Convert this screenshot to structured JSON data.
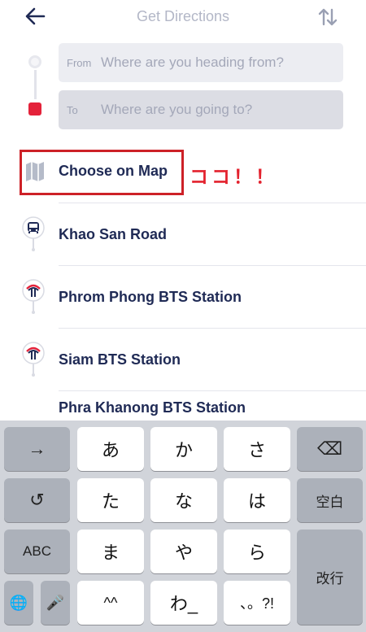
{
  "header": {
    "title": "Get Directions",
    "back_icon": "arrow-left-icon",
    "swap_icon": "swap-vertical-icon"
  },
  "route": {
    "from_label": "From",
    "from_placeholder": "Where are you heading from?",
    "to_label": "To",
    "to_placeholder": "Where are you going to?"
  },
  "annotation": "ココ！！",
  "places": [
    {
      "label": "Choose on Map",
      "icon": "map-icon"
    },
    {
      "label": "Khao San Road",
      "icon": "bus-stop-icon"
    },
    {
      "label": "Phrom Phong BTS Station",
      "icon": "bts-station-icon"
    },
    {
      "label": "Siam BTS Station",
      "icon": "bts-station-icon"
    },
    {
      "label": "Phra Khanong BTS Station",
      "icon": "bts-station-icon"
    }
  ],
  "keyboard": {
    "row1": [
      "→",
      "あ",
      "か",
      "さ",
      "⌫"
    ],
    "row2": [
      "↺",
      "た",
      "な",
      "は",
      "空白"
    ],
    "row3": [
      "ABC",
      "ま",
      "や",
      "ら",
      "改行"
    ],
    "row4": [
      "🌐",
      "🎤",
      "^^",
      "わ_",
      "、。?!"
    ]
  },
  "colors": {
    "accent_red": "#e4223a",
    "text_navy": "#1f2a55",
    "placeholder": "#a4a8b9"
  }
}
